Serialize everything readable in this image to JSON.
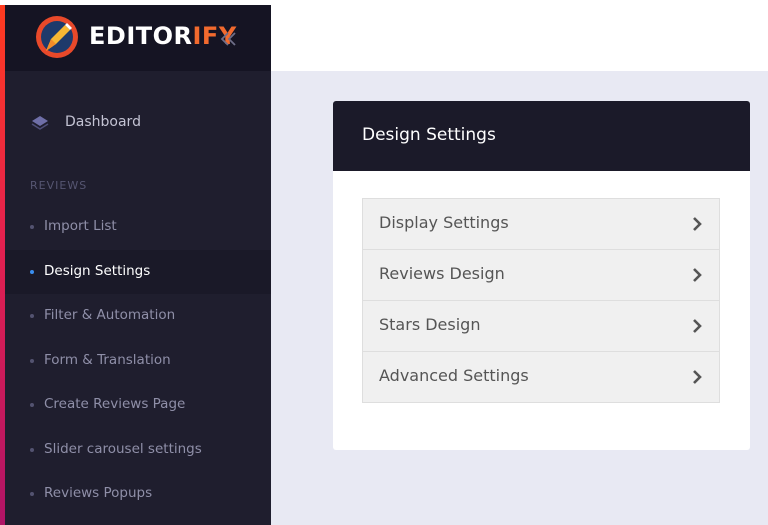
{
  "app": {
    "logo_text_main": "EDITOR",
    "logo_text_accent": "IFY",
    "accent_color": "#f26a2e",
    "icons": {
      "logo": "pencil-logo-icon",
      "collapse": "double-chevron-left-icon"
    }
  },
  "sidebar": {
    "dashboard": {
      "label": "Dashboard",
      "icon": "layers-icon"
    },
    "section_title": "REVIEWS",
    "items": [
      {
        "label": "Import List",
        "active": false
      },
      {
        "label": "Design Settings",
        "active": true
      },
      {
        "label": "Filter & Automation",
        "active": false
      },
      {
        "label": "Form & Translation",
        "active": false
      },
      {
        "label": "Create Reviews Page",
        "active": false
      },
      {
        "label": "Slider carousel settings",
        "active": false
      },
      {
        "label": "Reviews Popups",
        "active": false
      }
    ],
    "active_indicator_color": "#3a8ef0"
  },
  "main": {
    "card_title": "Design Settings",
    "settings": [
      {
        "label": "Display Settings",
        "icon": "chevron-right-icon"
      },
      {
        "label": "Reviews Design",
        "icon": "chevron-right-icon"
      },
      {
        "label": "Stars Design",
        "icon": "chevron-right-icon"
      },
      {
        "label": "Advanced Settings",
        "icon": "chevron-right-icon"
      }
    ]
  }
}
